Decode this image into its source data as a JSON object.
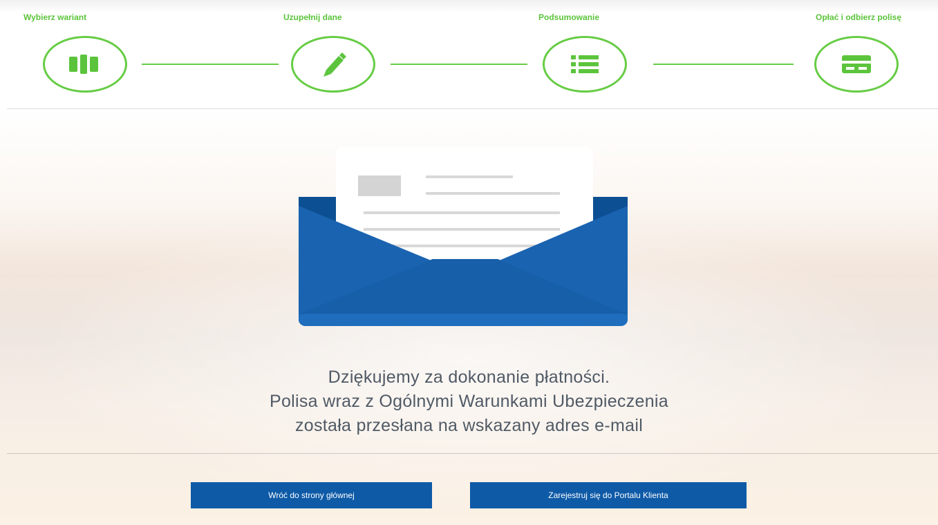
{
  "steps": [
    {
      "label": "Wybierz wariant",
      "icon": "bars-icon"
    },
    {
      "label": "Uzupełnij dane",
      "icon": "pencil-icon"
    },
    {
      "label": "Podsumowanie",
      "icon": "list-icon"
    },
    {
      "label": "Opłać i odbierz polisę",
      "icon": "card-icon"
    }
  ],
  "colors": {
    "accent_green": "#66cc44",
    "brand_blue": "#0e5aa7",
    "envelope_dark": "#0d4f93",
    "envelope_light": "#1f6dbd",
    "text": "#505a66"
  },
  "illustration": {
    "icon": "envelope-with-letter-icon"
  },
  "message": {
    "line1": "Dziękujemy za dokonanie płatności.",
    "line2": "Polisa wraz z Ogólnymi Warunkami Ubezpieczenia",
    "line3": "została przesłana na wskazany adres e-mail"
  },
  "buttons": {
    "home": "Wróć do strony głównej",
    "register": "Zarejestruj się do Portalu Klienta"
  }
}
